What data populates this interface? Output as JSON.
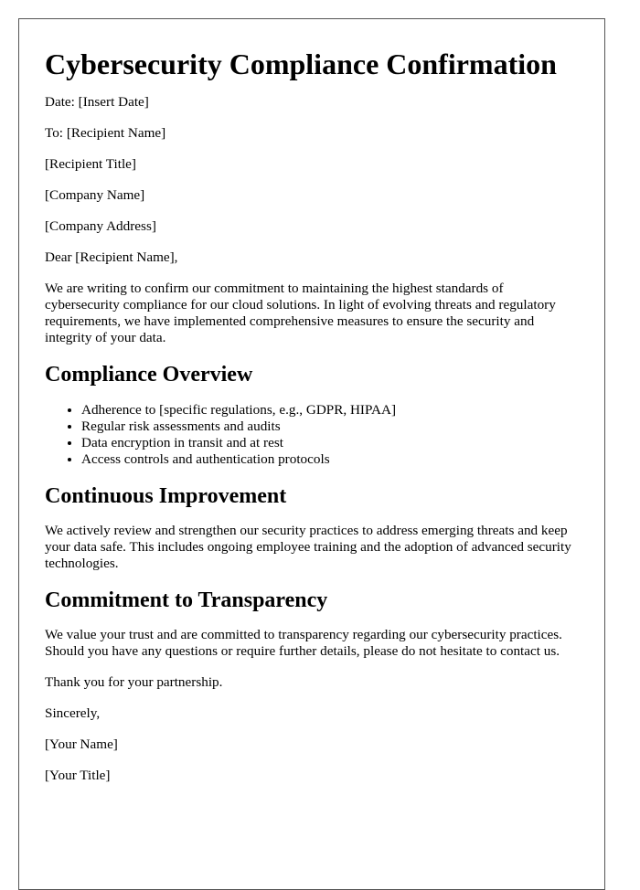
{
  "document": {
    "title": "Cybersecurity Compliance Confirmation",
    "header_lines": [
      "Date: [Insert Date]",
      "To: [Recipient Name]",
      "[Recipient Title]",
      "[Company Name]",
      "[Company Address]"
    ],
    "salutation": "Dear [Recipient Name],",
    "intro": "We are writing to confirm our commitment to maintaining the highest standards of cybersecurity compliance for our cloud solutions. In light of evolving threats and regulatory requirements, we have implemented comprehensive measures to ensure the security and integrity of your data.",
    "sections": [
      {
        "heading": "Compliance Overview",
        "items": [
          "Adherence to [specific regulations, e.g., GDPR, HIPAA]",
          "Regular risk assessments and audits",
          "Data encryption in transit and at rest",
          "Access controls and authentication protocols"
        ]
      },
      {
        "heading": "Continuous Improvement",
        "body": "We actively review and strengthen our security practices to address emerging threats and keep your data safe. This includes ongoing employee training and the adoption of advanced security technologies."
      },
      {
        "heading": "Commitment to Transparency",
        "body": "We value your trust and are committed to transparency regarding our cybersecurity practices. Should you have any questions or require further details, please do not hesitate to contact us."
      }
    ],
    "closing_thanks": "Thank you for your partnership.",
    "sign_off": "Sincerely,",
    "signature_lines": [
      "[Your Name]",
      "[Your Title]"
    ]
  }
}
